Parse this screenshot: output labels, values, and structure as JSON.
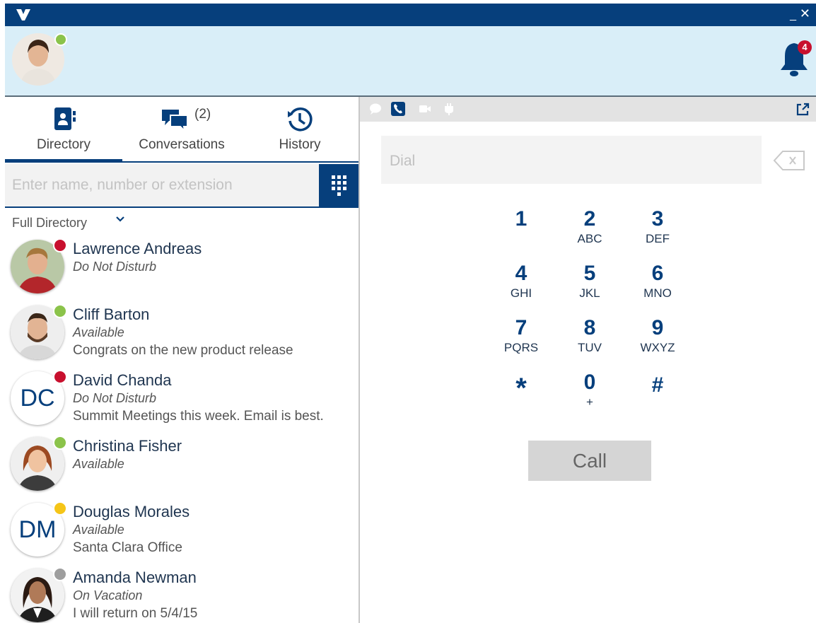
{
  "window": {
    "minimize_label": "_",
    "close_label": "✕"
  },
  "header": {
    "notification_count": "4",
    "my_status": "available"
  },
  "tabs": [
    {
      "label": "Directory",
      "icon": "directory-icon",
      "active": true
    },
    {
      "label": "Conversations",
      "icon": "conversations-icon",
      "count": "(2)"
    },
    {
      "label": "History",
      "icon": "history-icon"
    }
  ],
  "search": {
    "placeholder": "Enter name, number or extension"
  },
  "filter": {
    "label": "Full Directory"
  },
  "contacts": [
    {
      "name": "Lawrence Andreas",
      "status": "Do Not Disturb",
      "note": "",
      "initials": "",
      "status_color": "#c8102e",
      "status_icon": "do-not-disturb-icon"
    },
    {
      "name": "Cliff Barton",
      "status": "Available",
      "note": "Congrats on the new product release",
      "initials": "",
      "status_color": "#8bc34a",
      "status_icon": "available-icon"
    },
    {
      "name": "David Chanda",
      "status": "Do Not Disturb",
      "note": "Summit Meetings this week. Email is best.",
      "initials": "DC",
      "status_color": "#c8102e",
      "status_icon": "busy-call-icon"
    },
    {
      "name": "Christina Fisher",
      "status": "Available",
      "note": "",
      "initials": "",
      "status_color": "#8bc34a",
      "status_icon": "on-call-icon"
    },
    {
      "name": "Douglas Morales",
      "status": "Available",
      "note": "Santa Clara Office",
      "initials": "DM",
      "status_color": "#f5c518",
      "status_icon": "away-icon"
    },
    {
      "name": "Amanda Newman",
      "status": "On Vacation",
      "note": "I will return on 5/4/15",
      "initials": "",
      "status_color": "#9e9e9e",
      "status_icon": "vacation-icon"
    }
  ],
  "dialer": {
    "placeholder": "Dial",
    "keys": [
      {
        "digit": "1",
        "letters": ""
      },
      {
        "digit": "2",
        "letters": "ABC"
      },
      {
        "digit": "3",
        "letters": "DEF"
      },
      {
        "digit": "4",
        "letters": "GHI"
      },
      {
        "digit": "5",
        "letters": "JKL"
      },
      {
        "digit": "6",
        "letters": "MNO"
      },
      {
        "digit": "7",
        "letters": "PQRS"
      },
      {
        "digit": "8",
        "letters": "TUV"
      },
      {
        "digit": "9",
        "letters": "WXYZ"
      },
      {
        "digit": "*",
        "letters": ""
      },
      {
        "digit": "0",
        "letters": "+"
      },
      {
        "digit": "#",
        "letters": ""
      }
    ],
    "call_label": "Call"
  },
  "colors": {
    "brand": "#063f7c",
    "header_bg": "#d9eef8",
    "alert": "#c8102e"
  }
}
